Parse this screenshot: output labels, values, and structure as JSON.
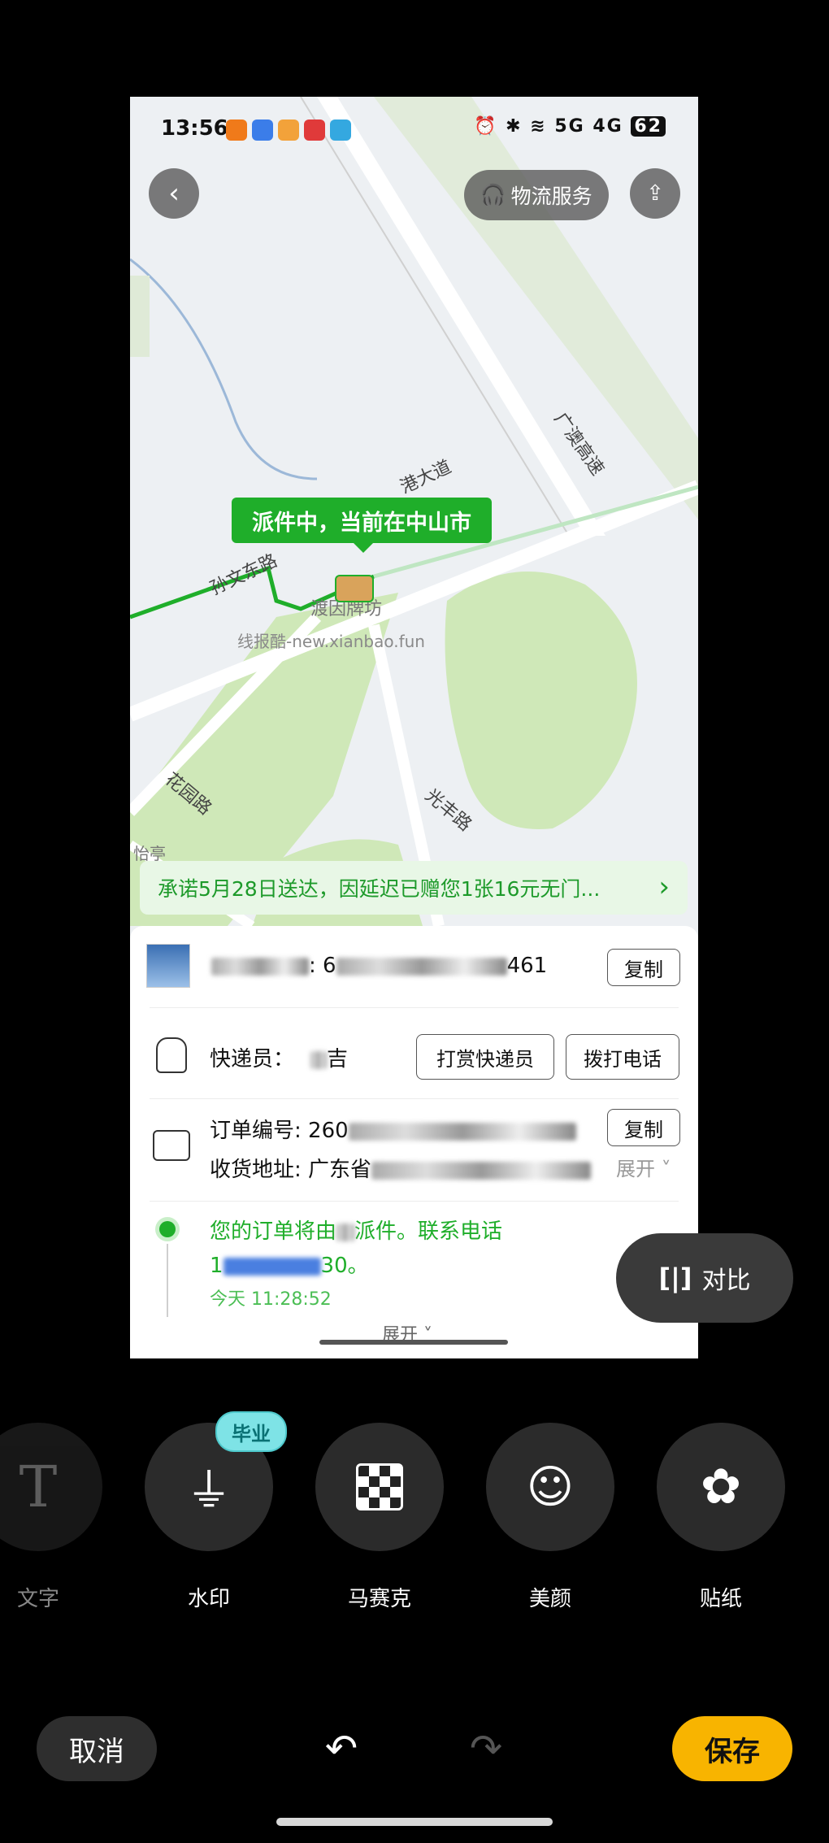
{
  "status_bar": {
    "time": "13:56",
    "battery": "62"
  },
  "top": {
    "logistics_service_label": "物流服务"
  },
  "map": {
    "labels": {
      "road_1": "孙文东路",
      "road_2": "港大道",
      "road_3": "广澳高速",
      "road_4": "花园路",
      "road_5": "光丰路",
      "place_1": "渡因牌坊",
      "place_2": "怡亭"
    },
    "watermark": "线报酷-new.xianbao.fun",
    "courier_bubble": "派件中，当前在中山市"
  },
  "promo_banner": {
    "text": "承诺5月28日送达，因延迟已赠您1张16元无门...",
    "chevron": "›"
  },
  "package": {
    "tracking_prefix": ": 6",
    "tracking_suffix": "461",
    "copy_label": "复制"
  },
  "courier": {
    "label": "快递员：",
    "name_partial": "吉",
    "tip_label": "打赏快递员",
    "call_label": "拨打电话"
  },
  "order": {
    "order_no_label": "订单编号: 260",
    "address_label": "收货地址: 广东省",
    "copy_label": "复制",
    "expand_label": "展开"
  },
  "timeline": {
    "message_start": "您的订单将由",
    "message_end": "派件。联系电话",
    "phone_start": "1",
    "phone_end": "30。",
    "time": "今天 11:28:52",
    "expand_label": "展开"
  },
  "compare_button": {
    "label": "对比"
  },
  "tools": [
    {
      "label": "文字"
    },
    {
      "label": "水印"
    },
    {
      "label": "马赛克"
    },
    {
      "label": "美颜"
    },
    {
      "label": "贴纸"
    }
  ],
  "watermark_badge": "毕业",
  "bottom": {
    "cancel_label": "取消",
    "save_label": "保存"
  },
  "colors": {
    "accent_green": "#1fae2a",
    "save_yellow": "#f8b400",
    "badge_cyan": "#7ee3e6"
  }
}
